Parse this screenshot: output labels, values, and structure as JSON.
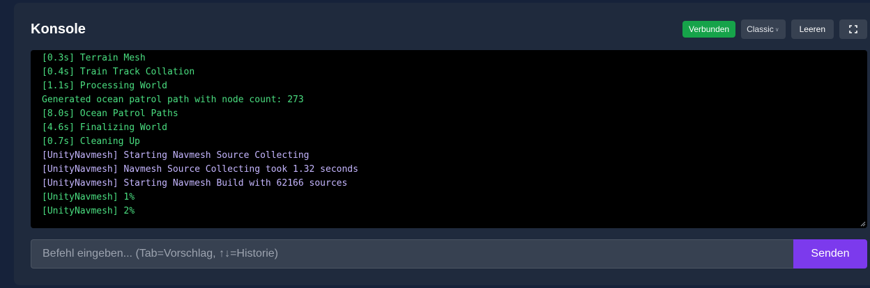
{
  "console": {
    "title": "Konsole",
    "status_badge": "Verbunden",
    "mode_select": "Classic",
    "clear_label": "Leeren",
    "fullscreen_icon": "fullscreen-icon",
    "lines": [
      {
        "text": "[0.3s] Terrain Mesh",
        "color": "green"
      },
      {
        "text": "[0.4s] Train Track Collation",
        "color": "green"
      },
      {
        "text": "[1.1s] Processing World",
        "color": "green"
      },
      {
        "text": "Generated ocean patrol path with node count: 273",
        "color": "green"
      },
      {
        "text": "[8.0s] Ocean Patrol Paths",
        "color": "green"
      },
      {
        "text": "[4.6s] Finalizing World",
        "color": "green"
      },
      {
        "text": "[0.7s] Cleaning Up",
        "color": "green"
      },
      {
        "text": "[UnityNavmesh] Starting Navmesh Source Collecting",
        "color": "purple"
      },
      {
        "text": "[UnityNavmesh] Navmesh Source Collecting took 1.32 seconds",
        "color": "purple"
      },
      {
        "text": "[UnityNavmesh] Starting Navmesh Build with 62166 sources",
        "color": "purple"
      },
      {
        "text": "[UnityNavmesh] 1%",
        "color": "green"
      },
      {
        "text": "[UnityNavmesh] 2%",
        "color": "green"
      }
    ],
    "input_placeholder": "Befehl eingeben... (Tab=Vorschlag, ↑↓=Historie)",
    "input_value": "",
    "send_label": "Senden"
  },
  "colors": {
    "accent": "#7c3aed",
    "status_ok": "#16a34a",
    "log_green": "#4ade80",
    "log_purple": "#c4b5fd"
  }
}
